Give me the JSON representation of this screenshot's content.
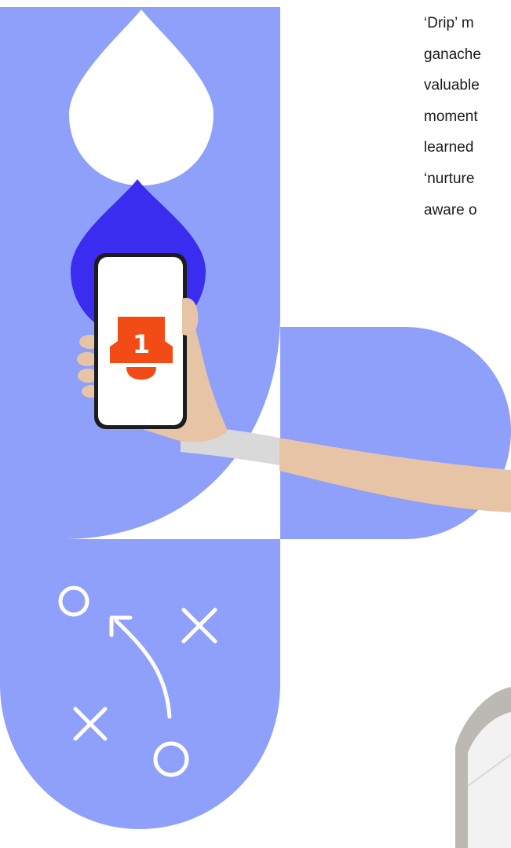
{
  "article": {
    "lines": [
      "‘Drip’ m",
      "ganache",
      "valuable",
      "moment",
      "learned",
      "‘nurture",
      "aware o"
    ]
  },
  "notification": {
    "badge_count": "1"
  },
  "colors": {
    "periwinkle": "#8fa0fb",
    "indigo": "#3a2df0",
    "alert_orange": "#f24b15",
    "white": "#ffffff",
    "text": "#1b1b1b"
  },
  "icons": [
    "droplet-icon",
    "bell-icon",
    "circle-icon",
    "cross-icon",
    "curved-arrow-icon",
    "envelope-icon"
  ]
}
